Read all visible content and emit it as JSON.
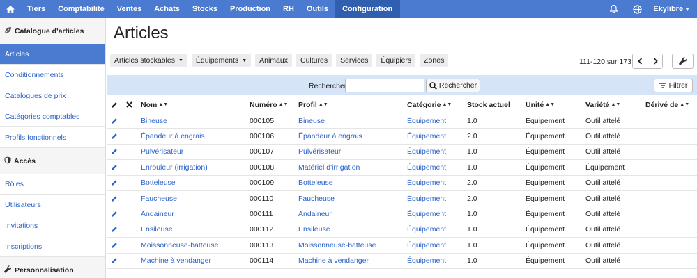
{
  "nav": {
    "items": [
      "Tiers",
      "Comptabilité",
      "Ventes",
      "Achats",
      "Stocks",
      "Production",
      "RH",
      "Outils",
      "Configuration"
    ],
    "active": "Configuration",
    "user": "Ekylibre",
    "icons": [
      "home-icon",
      "bell-icon",
      "globe-icon"
    ]
  },
  "sidebar": {
    "sections": [
      {
        "title": "Catalogue d'articles",
        "icon": "leaf-icon",
        "items": [
          "Articles",
          "Conditionnements",
          "Catalogues de prix",
          "Catégories comptables",
          "Profils fonctionnels"
        ]
      },
      {
        "title": "Accès",
        "icon": "shield-icon",
        "items": [
          "Rôles",
          "Utilisateurs",
          "Invitations",
          "Inscriptions"
        ]
      },
      {
        "title": "Personnalisation",
        "icon": "wrench-icon",
        "items": []
      }
    ],
    "active_item": "Articles"
  },
  "page": {
    "title": "Articles"
  },
  "filters": {
    "chips": [
      "Articles stockables",
      "Équipements",
      "Animaux",
      "Cultures",
      "Services",
      "Équipiers",
      "Zones"
    ]
  },
  "pagination": {
    "info": "111-120 sur 173"
  },
  "search": {
    "label": "Rechercher",
    "value": "",
    "button": "Rechercher",
    "filter_button": "Filtrer"
  },
  "table": {
    "columns": [
      "Nom",
      "Numéro",
      "Profil",
      "Catégorie",
      "Stock actuel",
      "Unité",
      "Variété",
      "Dérivé de"
    ],
    "rows": [
      {
        "nom": "Bineuse",
        "numero": "000105",
        "profil": "Bineuse",
        "categorie": "Équipement",
        "stock": "1.0",
        "unite": "Équipement",
        "variete": "Outil attelé"
      },
      {
        "nom": "Épandeur à engrais",
        "numero": "000106",
        "profil": "Épandeur à engrais",
        "categorie": "Équipement",
        "stock": "2.0",
        "unite": "Équipement",
        "variete": "Outil attelé"
      },
      {
        "nom": "Pulvérisateur",
        "numero": "000107",
        "profil": "Pulvérisateur",
        "categorie": "Équipement",
        "stock": "1.0",
        "unite": "Équipement",
        "variete": "Outil attelé"
      },
      {
        "nom": "Enrouleur (irrigation)",
        "numero": "000108",
        "profil": "Matériel d'irrigation",
        "categorie": "Équipement",
        "stock": "1.0",
        "unite": "Équipement",
        "variete": "Équipement"
      },
      {
        "nom": "Botteleuse",
        "numero": "000109",
        "profil": "Botteleuse",
        "categorie": "Équipement",
        "stock": "2.0",
        "unite": "Équipement",
        "variete": "Outil attelé"
      },
      {
        "nom": "Faucheuse",
        "numero": "000110",
        "profil": "Faucheuse",
        "categorie": "Équipement",
        "stock": "2.0",
        "unite": "Équipement",
        "variete": "Outil attelé"
      },
      {
        "nom": "Andaineur",
        "numero": "000111",
        "profil": "Andaineur",
        "categorie": "Équipement",
        "stock": "1.0",
        "unite": "Équipement",
        "variete": "Outil attelé"
      },
      {
        "nom": "Ensileuse",
        "numero": "000112",
        "profil": "Ensileuse",
        "categorie": "Équipement",
        "stock": "1.0",
        "unite": "Équipement",
        "variete": "Outil attelé"
      },
      {
        "nom": "Moissonneuse-batteuse",
        "numero": "000113",
        "profil": "Moissonneuse-batteuse",
        "categorie": "Équipement",
        "stock": "1.0",
        "unite": "Équipement",
        "variete": "Outil attelé"
      },
      {
        "nom": "Machine à vendanger",
        "numero": "000114",
        "profil": "Machine à vendanger",
        "categorie": "Équipement",
        "stock": "1.0",
        "unite": "Équipement",
        "variete": "Outil attelé"
      }
    ]
  },
  "colors": {
    "navbar": "#4a7bd0",
    "navbar_active": "#2f5fae",
    "link": "#2a62c9",
    "search_band": "#d6e4f7"
  }
}
